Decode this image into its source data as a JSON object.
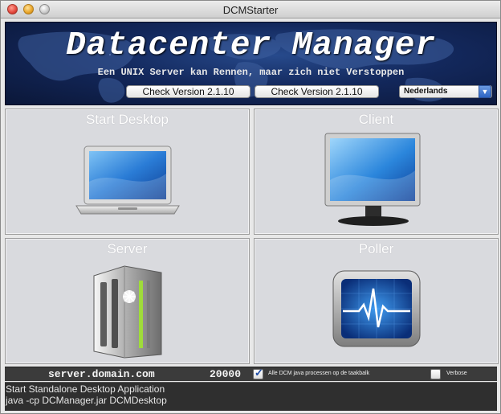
{
  "window": {
    "title": "DCMStarter"
  },
  "banner": {
    "title": "Datacenter Manager",
    "subtitle": "Een UNIX Server kan Rennen, maar zich niet Verstoppen",
    "check_button_1": "Check Version 2.1.10",
    "check_button_2": "Check Version 2.1.10",
    "language": "Nederlands"
  },
  "tiles": [
    {
      "label": "Start Desktop",
      "icon": "laptop-icon"
    },
    {
      "label": "Client",
      "icon": "monitor-icon"
    },
    {
      "label": "Server",
      "icon": "server-icon"
    },
    {
      "label": "Poller",
      "icon": "heartbeat-monitor-icon"
    }
  ],
  "statusbar": {
    "host": "server.domain.com",
    "port": "20000",
    "taskbar_checkbox_label": "Alle DCM java processen op de taakbalk",
    "taskbar_checked": true,
    "verbose_label": "Verbose",
    "verbose_checked": false
  },
  "console": {
    "line1": "Start Standalone Desktop Application",
    "line2": "java -cp DCManager.jar DCMDesktop"
  },
  "colors": {
    "banner_bg": "#13285c",
    "tile_bg": "#d9dade",
    "status_bg": "#3b3b3b",
    "checkbox_accent": "#1d4ba5",
    "select_accent": "#2d64c4"
  }
}
